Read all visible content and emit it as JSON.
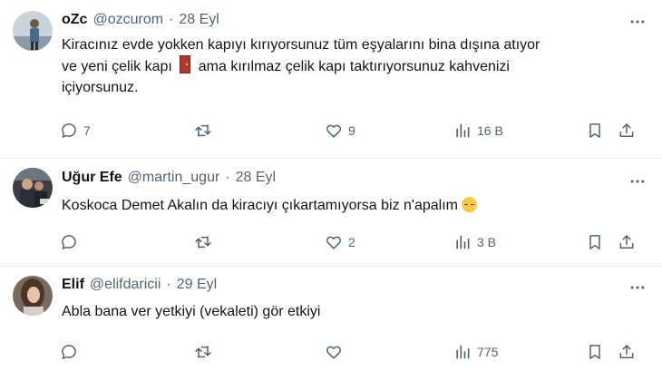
{
  "tweets": [
    {
      "name": "oZc",
      "handle": "@ozcurom",
      "date": "28 Eyl",
      "text_line1": "Kiracınız evde yokken kapıyı kırıyorsunuz tüm eşyalarını bina dışına atıyor",
      "text_line2a": "ve yeni çelik kapı",
      "text_line2b": "ama kırılmaz çelik kapı taktırıyorsunuz kahvenizi",
      "text_line3": "içiyorsunuz.",
      "emoji": "door-emoji",
      "replies": "7",
      "retweets": "",
      "likes": "9",
      "views": "16 B"
    },
    {
      "name": "Uğur Efe",
      "handle": "@martin_ugur",
      "date": "28 Eyl",
      "text": "Koskoca Demet Akalın da kiracıyı çıkartamıyorsa biz n'apalım",
      "emoji": "pensive-face-emoji",
      "replies": "",
      "retweets": "",
      "likes": "2",
      "views": "3 B"
    },
    {
      "name": "Elif",
      "handle": "@elifdaricii",
      "date": "29 Eyl",
      "text": "Abla bana ver yetkiyi (vekaleti) gör etkiyi",
      "replies": "",
      "retweets": "",
      "likes": "",
      "views": "775"
    }
  ],
  "separator": "·",
  "icons": [
    "reply-icon",
    "retweet-icon",
    "like-icon",
    "views-icon",
    "bookmark-icon",
    "share-icon",
    "more-icon"
  ],
  "colors": {
    "text": "#0f1419",
    "secondary": "#536471",
    "divider": "#e6ecf0"
  }
}
